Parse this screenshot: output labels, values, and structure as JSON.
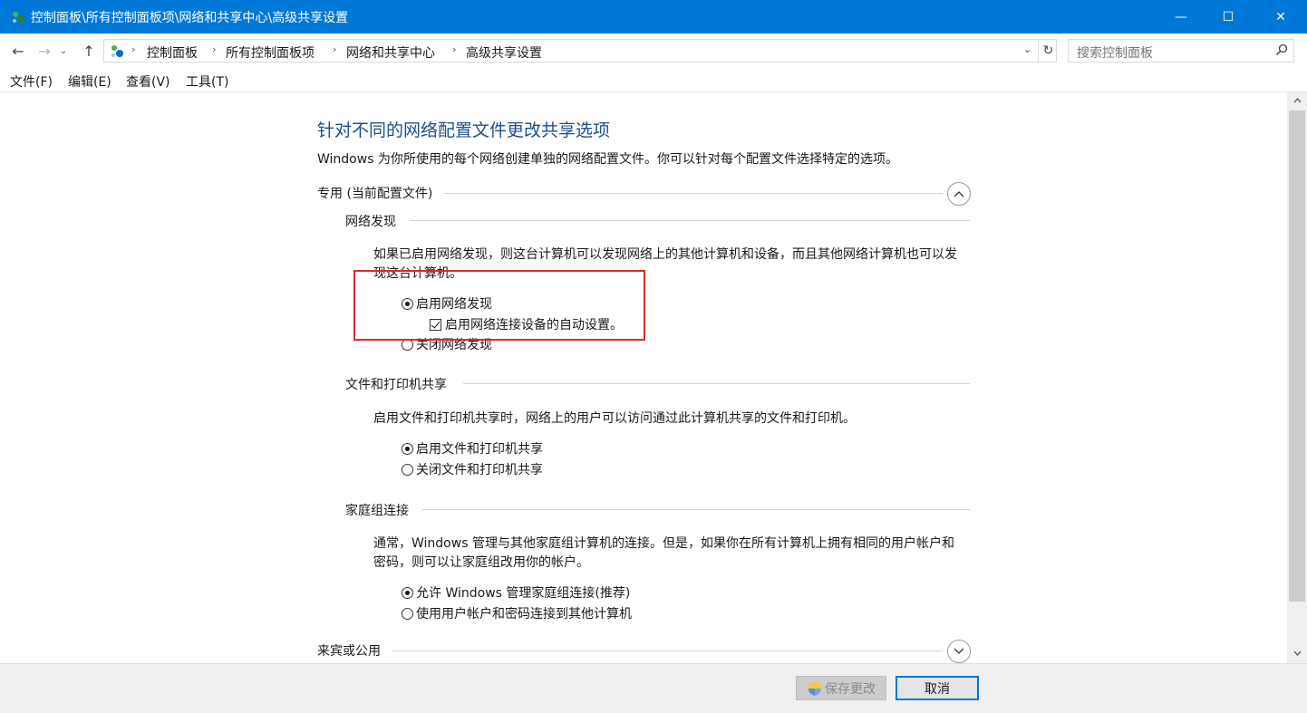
{
  "window": {
    "title": "控制面板\\所有控制面板项\\网络和共享中心\\高级共享设置",
    "minimize_glyph": "—",
    "maximize_glyph": "☐",
    "close_glyph": "✕",
    "accent": "#0078d7"
  },
  "nav": {
    "back_glyph": "←",
    "forward_glyph": "→",
    "recent_glyph": "⌄",
    "up_glyph": "↑",
    "breadcrumbs": [
      "控制面板",
      "所有控制面板项",
      "网络和共享中心",
      "高级共享设置"
    ],
    "separator": "›",
    "dropdown_glyph": "⌄",
    "refresh_glyph": "↻"
  },
  "search": {
    "placeholder": "搜索控制面板"
  },
  "menu": [
    "文件(F)",
    "编辑(E)",
    "查看(V)",
    "工具(T)"
  ],
  "page": {
    "title": "针对不同的网络配置文件更改共享选项",
    "description": "Windows 为你所使用的每个网络创建单独的网络配置文件。你可以针对每个配置文件选择特定的选项。",
    "profile_private": {
      "label": "专用 (当前配置文件)",
      "expanded": true,
      "network_discovery": {
        "label": "网络发现",
        "description": "如果已启用网络发现，则这台计算机可以发现网络上的其他计算机和设备，而且其他网络计算机也可以发现这台计算机。",
        "options": [
          {
            "label": "启用网络发现",
            "selected": true
          },
          {
            "label": "关闭网络发现",
            "selected": false
          }
        ],
        "auto_setup": {
          "label": "启用网络连接设备的自动设置。",
          "checked": true
        }
      },
      "file_printer_sharing": {
        "label": "文件和打印机共享",
        "description": "启用文件和打印机共享时，网络上的用户可以访问通过此计算机共享的文件和打印机。",
        "options": [
          {
            "label": "启用文件和打印机共享",
            "selected": true
          },
          {
            "label": "关闭文件和打印机共享",
            "selected": false
          }
        ]
      },
      "homegroup": {
        "label": "家庭组连接",
        "description": "通常，Windows 管理与其他家庭组计算机的连接。但是，如果你在所有计算机上拥有相同的用户帐户和密码，则可以让家庭组改用你的帐户。",
        "options": [
          {
            "label": "允许 Windows 管理家庭组连接(推荐)",
            "selected": true
          },
          {
            "label": "使用用户帐户和密码连接到其他计算机",
            "selected": false
          }
        ]
      }
    },
    "profile_guest": {
      "label": "来宾或公用",
      "expanded": false
    }
  },
  "footer": {
    "save_label": "保存更改",
    "save_enabled": false,
    "cancel_label": "取消"
  },
  "highlight_color": "#e0282a"
}
